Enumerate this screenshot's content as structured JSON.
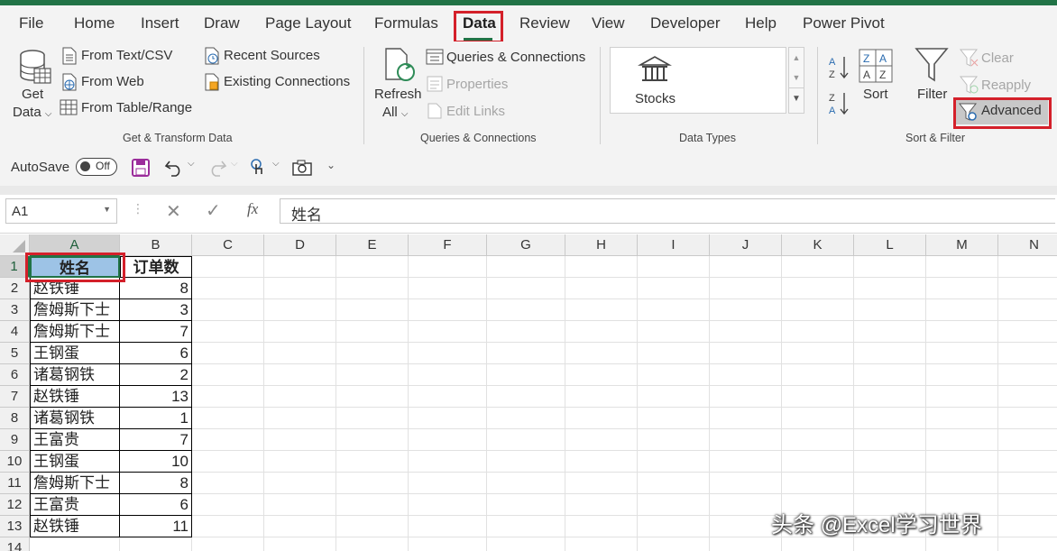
{
  "tabs": [
    "File",
    "Home",
    "Insert",
    "Draw",
    "Page Layout",
    "Formulas",
    "Data",
    "Review",
    "View",
    "Developer",
    "Help",
    "Power Pivot"
  ],
  "active_tab": "Data",
  "ribbon": {
    "get_data": [
      "Get",
      "Data"
    ],
    "from_text_csv": "From Text/CSV",
    "from_web": "From Web",
    "from_table_range": "From Table/Range",
    "recent_sources": "Recent Sources",
    "existing_connections": "Existing Connections",
    "group_get_transform": "Get & Transform Data",
    "refresh_all": [
      "Refresh",
      "All"
    ],
    "queries_connections": "Queries & Connections",
    "properties": "Properties",
    "edit_links": "Edit Links",
    "group_queries": "Queries & Connections",
    "stocks": "Stocks",
    "group_data_types": "Data Types",
    "sort": "Sort",
    "filter": "Filter",
    "clear": "Clear",
    "reapply": "Reapply",
    "advanced": "Advanced",
    "group_sort_filter": "Sort & Filter"
  },
  "qat": {
    "autosave": "AutoSave",
    "toggle": "Off"
  },
  "formula_bar": {
    "name_box": "A1",
    "fx": "fx",
    "content": "姓名"
  },
  "sheet": {
    "columns": [
      "A",
      "B",
      "C",
      "D",
      "E",
      "F",
      "G",
      "H",
      "I",
      "J",
      "K",
      "L",
      "M",
      "N"
    ],
    "rows": [
      "1",
      "2",
      "3",
      "4",
      "5",
      "6",
      "7",
      "8",
      "9",
      "10",
      "11",
      "12",
      "13",
      "14"
    ],
    "header": {
      "name": "姓名",
      "orders": "订单数"
    },
    "data": [
      {
        "name": "赵铁锤",
        "orders": "8"
      },
      {
        "name": "詹姆斯下士",
        "orders": "3"
      },
      {
        "name": "詹姆斯下士",
        "orders": "7"
      },
      {
        "name": "王钢蛋",
        "orders": "6"
      },
      {
        "name": "诸葛钢铁",
        "orders": "2"
      },
      {
        "name": "赵铁锤",
        "orders": "13"
      },
      {
        "name": "诸葛钢铁",
        "orders": "1"
      },
      {
        "name": "王富贵",
        "orders": "7"
      },
      {
        "name": "王钢蛋",
        "orders": "10"
      },
      {
        "name": "詹姆斯下士",
        "orders": "8"
      },
      {
        "name": "王富贵",
        "orders": "6"
      },
      {
        "name": "赵铁锤",
        "orders": "11"
      }
    ]
  },
  "watermark": "头条 @Excel学习世界",
  "colors": {
    "excel_green": "#217346",
    "highlight_red": "#d4202a",
    "header_cell_fill": "#9dc3e6"
  }
}
